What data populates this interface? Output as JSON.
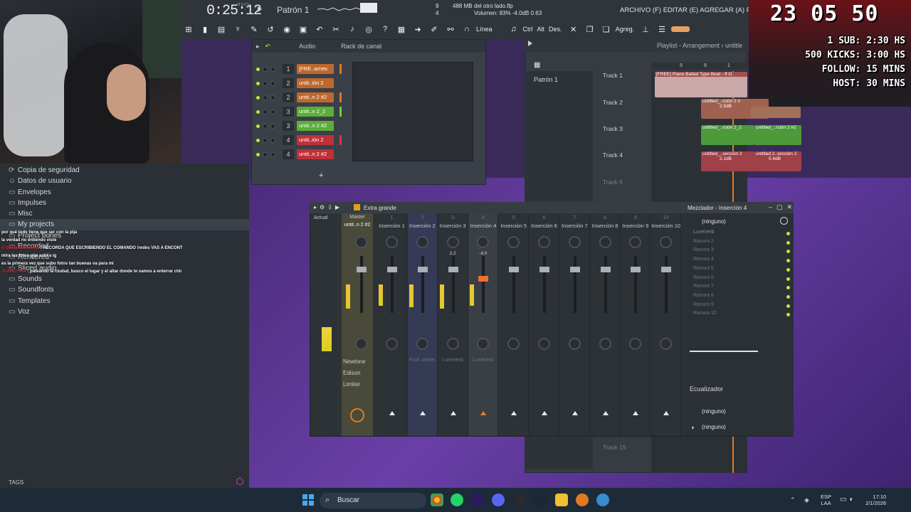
{
  "topbar": {
    "time": "0:25:12",
    "time_unit": "M:S:CS",
    "pattern": "Patrón 1",
    "file_name": "del otro lado.flp",
    "memory": "488 MB",
    "count_a": "9",
    "count_b": "4",
    "volume": "Volumen: 83% -4.0dB  0.63",
    "menu": "ARCHIVO (F) EDITAR (E) AGREGAR (A) PATRONES (P) V",
    "snap": "Línea",
    "toolbar_texts": [
      "Ctrl",
      "Alt",
      "Des.",
      "Agreg."
    ]
  },
  "overlay": {
    "clock": "23 05 50",
    "lines": [
      "1 SUB: 2:30 HS",
      "500 KICKS: 3:00 HS",
      "FOLLOW: 15 MINS",
      "HOST: 30 MINS"
    ]
  },
  "browser": {
    "items": [
      "Copia de seguridad",
      "Datos de usuario",
      "Envelopes",
      "Impulses",
      "Misc",
      "My projects",
      "Project bones",
      "Recorded",
      "Rendered",
      "Sliced audio",
      "Sounds",
      "Soundfonts",
      "Templates",
      "Voz"
    ],
    "tags": "TAGS"
  },
  "chat": [
    {
      "user": "",
      "text": "por qué todo tiene que ser con la pija"
    },
    {
      "user": "",
      "text": "la verdad no entiendo viste"
    },
    {
      "user": "@StreamElements",
      "text": ": RECORDA QUE ESCRIBIENDO EL COMANDO !redes VAS A ENCONTRAR TODAS MIS REDES SOCIALES DONDE PODES SEGUIRME :)"
    },
    {
      "user": "",
      "text": "mira las fotos que subí a ig"
    },
    {
      "user": "",
      "text": "es la primera vez que subo fotos tan buenas va para mi"
    },
    {
      "user": "JUANCY404",
      "text": ": pateando la ciudad, busco el lugar y el altar donde te vamos a enterrar chirio me queres tirar un tema no tenes barras y menos poco de oportunidad te estoy enseñando lo que es el rap a fuera tus letras y tus lemas"
    }
  ],
  "channel_rack": {
    "tab": "Audio",
    "title": "Rack de canal",
    "rows": [
      {
        "num": "1",
        "name": "[FRE..arnes",
        "color": "#c0682c",
        "bar": "#e07a20"
      },
      {
        "num": "2",
        "name": "untit..ión 2",
        "color": "#c0682c",
        "bar": ""
      },
      {
        "num": "2",
        "name": "untit..n 2 #2",
        "color": "#c0682c",
        "bar": "#e07a20"
      },
      {
        "num": "3",
        "name": "untit..n 2_2",
        "color": "#5cae3a",
        "bar": "#6cd040"
      },
      {
        "num": "3",
        "name": "untit..n 2 #2",
        "color": "#5cae3a",
        "bar": ""
      },
      {
        "num": "4",
        "name": "untit..ión 2",
        "color": "#c0303a",
        "bar": "#e03040"
      },
      {
        "num": "4",
        "name": "untit..n 2 #2",
        "color": "#c0303a",
        "bar": ""
      }
    ],
    "add": "+"
  },
  "playlist": {
    "title": "Playlist - Arrangement › untitle",
    "pattern": "Patrón 1",
    "tracks": [
      "Track 1",
      "Track 2",
      "Track 3",
      "Track 4",
      "Track 5",
      "Track 15"
    ],
    "clip_labels": [
      "[FREE] Piano Ballad Type Beat - If O",
      "untitled_..rción 2 #",
      "untitled_..rción 2_2",
      "untitled_..rción 2 #2",
      "untitled_..sección 2",
      "untitled 2..sección 2"
    ],
    "db_labels": [
      "2.5dB",
      "2.1dB",
      "0.4dB"
    ],
    "bar_numbers": [
      "5",
      "9",
      "1"
    ]
  },
  "mixer": {
    "preset": "Extra grande",
    "title": "Mezclador - Inserción 4",
    "current_label": "Actual",
    "master_label": "Master",
    "master_name": "untit..n 2 #2",
    "strips": [
      "Inserción 1",
      "Inserción 2",
      "Inserción 3",
      "Inserción 4",
      "Inserción 5",
      "Inserción 6",
      "Inserción 7",
      "Inserción 8",
      "Inserción 9",
      "Inserción 10"
    ],
    "strip_numbers": [
      "1",
      "2",
      "3",
      "4",
      "5",
      "6",
      "7",
      "8",
      "9",
      "10"
    ],
    "vals": [
      "2.2",
      "-4.0"
    ],
    "fx": [
      "Fruit..volver",
      "LuxeVerb",
      "LuxeVerb"
    ],
    "master_fx": [
      "Newtone",
      "Edison",
      "Limiter"
    ],
    "none": "(ninguno)",
    "slots": [
      "LuxeVerb",
      "Ranura 2",
      "Ranura 3",
      "Ranura 4",
      "Ranura 5",
      "Ranura 6",
      "Ranura 7",
      "Ranura 8",
      "Ranura 9",
      "Ranura 10"
    ],
    "eq_label": "Ecualizador"
  },
  "taskbar": {
    "search": "Buscar",
    "lang1": "ESP",
    "lang2": "LAA",
    "time": "17:10",
    "date": "2/1/2026"
  }
}
